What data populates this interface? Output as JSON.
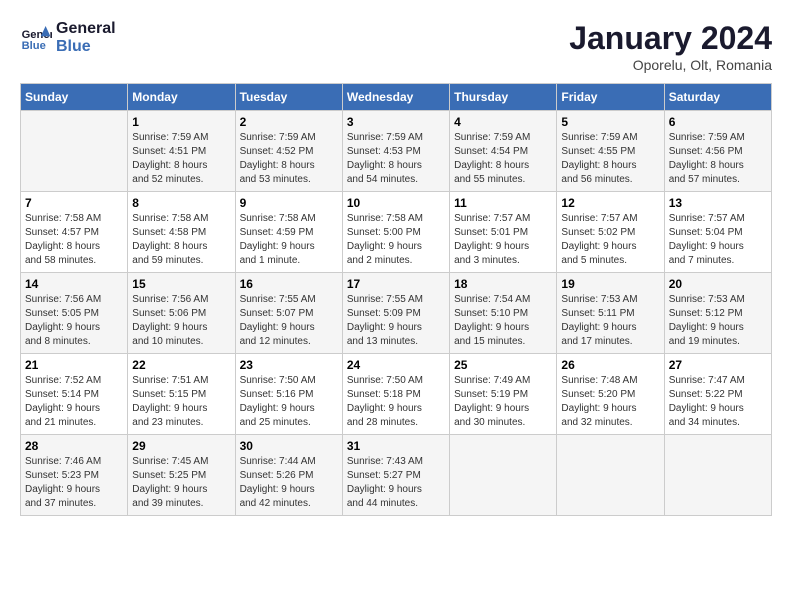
{
  "header": {
    "logo_line1": "General",
    "logo_line2": "Blue",
    "month_title": "January 2024",
    "subtitle": "Oporelu, Olt, Romania"
  },
  "weekdays": [
    "Sunday",
    "Monday",
    "Tuesday",
    "Wednesday",
    "Thursday",
    "Friday",
    "Saturday"
  ],
  "weeks": [
    [
      {
        "day": "",
        "info": ""
      },
      {
        "day": "1",
        "info": "Sunrise: 7:59 AM\nSunset: 4:51 PM\nDaylight: 8 hours\nand 52 minutes."
      },
      {
        "day": "2",
        "info": "Sunrise: 7:59 AM\nSunset: 4:52 PM\nDaylight: 8 hours\nand 53 minutes."
      },
      {
        "day": "3",
        "info": "Sunrise: 7:59 AM\nSunset: 4:53 PM\nDaylight: 8 hours\nand 54 minutes."
      },
      {
        "day": "4",
        "info": "Sunrise: 7:59 AM\nSunset: 4:54 PM\nDaylight: 8 hours\nand 55 minutes."
      },
      {
        "day": "5",
        "info": "Sunrise: 7:59 AM\nSunset: 4:55 PM\nDaylight: 8 hours\nand 56 minutes."
      },
      {
        "day": "6",
        "info": "Sunrise: 7:59 AM\nSunset: 4:56 PM\nDaylight: 8 hours\nand 57 minutes."
      }
    ],
    [
      {
        "day": "7",
        "info": "Sunrise: 7:58 AM\nSunset: 4:57 PM\nDaylight: 8 hours\nand 58 minutes."
      },
      {
        "day": "8",
        "info": "Sunrise: 7:58 AM\nSunset: 4:58 PM\nDaylight: 8 hours\nand 59 minutes."
      },
      {
        "day": "9",
        "info": "Sunrise: 7:58 AM\nSunset: 4:59 PM\nDaylight: 9 hours\nand 1 minute."
      },
      {
        "day": "10",
        "info": "Sunrise: 7:58 AM\nSunset: 5:00 PM\nDaylight: 9 hours\nand 2 minutes."
      },
      {
        "day": "11",
        "info": "Sunrise: 7:57 AM\nSunset: 5:01 PM\nDaylight: 9 hours\nand 3 minutes."
      },
      {
        "day": "12",
        "info": "Sunrise: 7:57 AM\nSunset: 5:02 PM\nDaylight: 9 hours\nand 5 minutes."
      },
      {
        "day": "13",
        "info": "Sunrise: 7:57 AM\nSunset: 5:04 PM\nDaylight: 9 hours\nand 7 minutes."
      }
    ],
    [
      {
        "day": "14",
        "info": "Sunrise: 7:56 AM\nSunset: 5:05 PM\nDaylight: 9 hours\nand 8 minutes."
      },
      {
        "day": "15",
        "info": "Sunrise: 7:56 AM\nSunset: 5:06 PM\nDaylight: 9 hours\nand 10 minutes."
      },
      {
        "day": "16",
        "info": "Sunrise: 7:55 AM\nSunset: 5:07 PM\nDaylight: 9 hours\nand 12 minutes."
      },
      {
        "day": "17",
        "info": "Sunrise: 7:55 AM\nSunset: 5:09 PM\nDaylight: 9 hours\nand 13 minutes."
      },
      {
        "day": "18",
        "info": "Sunrise: 7:54 AM\nSunset: 5:10 PM\nDaylight: 9 hours\nand 15 minutes."
      },
      {
        "day": "19",
        "info": "Sunrise: 7:53 AM\nSunset: 5:11 PM\nDaylight: 9 hours\nand 17 minutes."
      },
      {
        "day": "20",
        "info": "Sunrise: 7:53 AM\nSunset: 5:12 PM\nDaylight: 9 hours\nand 19 minutes."
      }
    ],
    [
      {
        "day": "21",
        "info": "Sunrise: 7:52 AM\nSunset: 5:14 PM\nDaylight: 9 hours\nand 21 minutes."
      },
      {
        "day": "22",
        "info": "Sunrise: 7:51 AM\nSunset: 5:15 PM\nDaylight: 9 hours\nand 23 minutes."
      },
      {
        "day": "23",
        "info": "Sunrise: 7:50 AM\nSunset: 5:16 PM\nDaylight: 9 hours\nand 25 minutes."
      },
      {
        "day": "24",
        "info": "Sunrise: 7:50 AM\nSunset: 5:18 PM\nDaylight: 9 hours\nand 28 minutes."
      },
      {
        "day": "25",
        "info": "Sunrise: 7:49 AM\nSunset: 5:19 PM\nDaylight: 9 hours\nand 30 minutes."
      },
      {
        "day": "26",
        "info": "Sunrise: 7:48 AM\nSunset: 5:20 PM\nDaylight: 9 hours\nand 32 minutes."
      },
      {
        "day": "27",
        "info": "Sunrise: 7:47 AM\nSunset: 5:22 PM\nDaylight: 9 hours\nand 34 minutes."
      }
    ],
    [
      {
        "day": "28",
        "info": "Sunrise: 7:46 AM\nSunset: 5:23 PM\nDaylight: 9 hours\nand 37 minutes."
      },
      {
        "day": "29",
        "info": "Sunrise: 7:45 AM\nSunset: 5:25 PM\nDaylight: 9 hours\nand 39 minutes."
      },
      {
        "day": "30",
        "info": "Sunrise: 7:44 AM\nSunset: 5:26 PM\nDaylight: 9 hours\nand 42 minutes."
      },
      {
        "day": "31",
        "info": "Sunrise: 7:43 AM\nSunset: 5:27 PM\nDaylight: 9 hours\nand 44 minutes."
      },
      {
        "day": "",
        "info": ""
      },
      {
        "day": "",
        "info": ""
      },
      {
        "day": "",
        "info": ""
      }
    ]
  ]
}
